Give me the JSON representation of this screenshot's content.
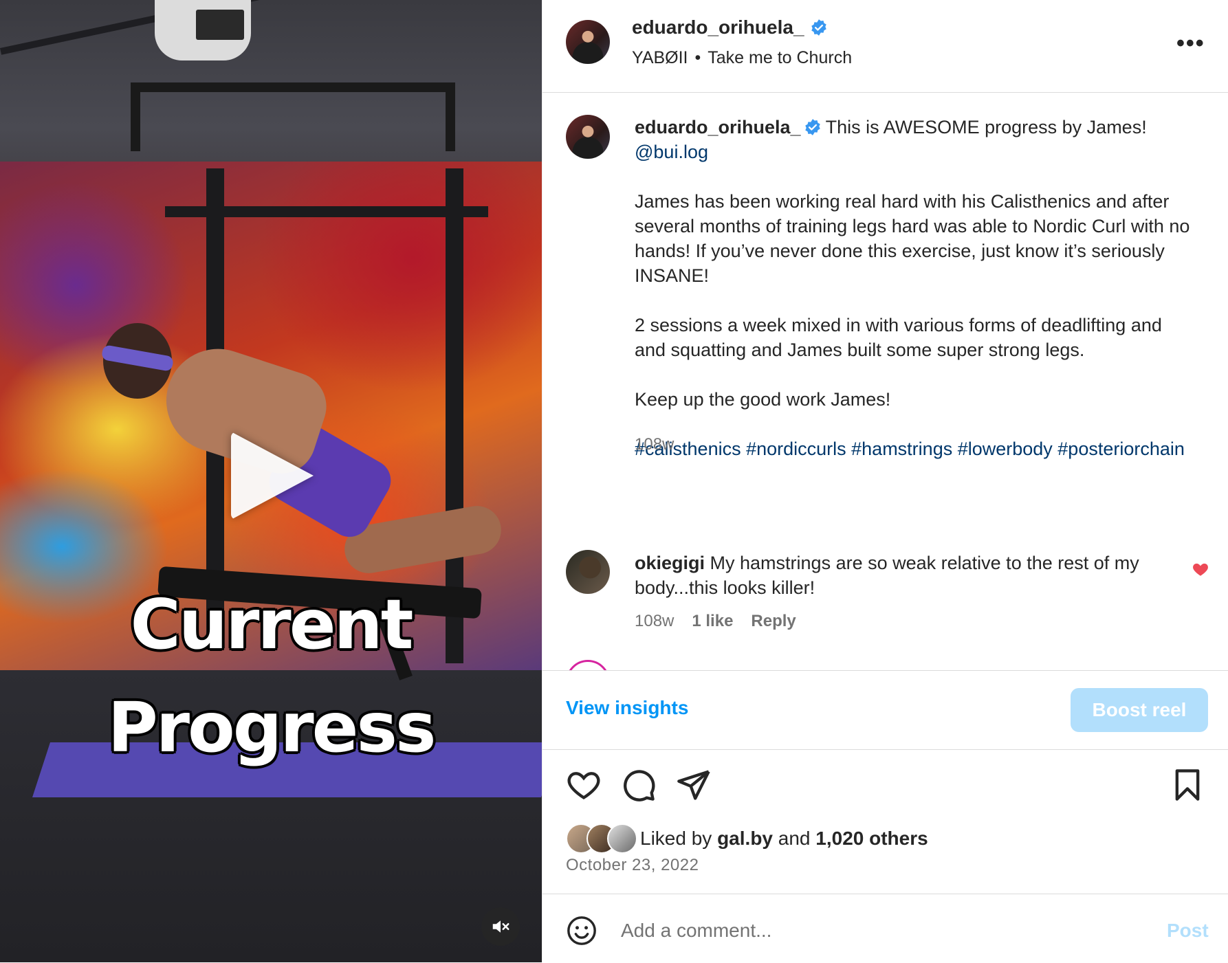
{
  "video": {
    "overlay_line1": "Current",
    "overlay_line2": "Progress",
    "play_icon": "play-icon",
    "mute_icon": "speaker-muted-icon"
  },
  "header": {
    "username": "eduardo_orihuela_",
    "verified": true,
    "audio_artist": "YABØII",
    "separator": "•",
    "audio_track": "Take me to Church",
    "more_label": "•••"
  },
  "caption": {
    "username": "eduardo_orihuela_",
    "intro": "This is AWESOME progress by James!",
    "mention": "@bui.log",
    "para1": "James has been working real hard with his Calisthenics and after several months of training legs hard was able to Nordic Curl with no hands! If you’ve never done this exercise, just know it’s seriously INSANE!",
    "para2": "2 sessions a week mixed in with various forms of deadlifting and and squatting and James built some super strong legs.",
    "para3": "Keep up the good work James!",
    "hashtags": "#calisthenics #nordiccurls #hamstrings #lowerbody #posteriorchain",
    "time": "108w"
  },
  "comment": {
    "username": "okiegigi",
    "text": "My hamstrings are so weak relative to the rest of my body...this looks killer!",
    "time": "108w",
    "likes": "1 like",
    "reply": "Reply",
    "liked": true
  },
  "insights": {
    "view_label": "View insights",
    "boost_label": "Boost reel"
  },
  "likes": {
    "prefix": "Liked by",
    "first_user": "gal.by",
    "conjunction": "and",
    "others": "1,020 others",
    "date": "October 23, 2022"
  },
  "add_comment": {
    "placeholder": "Add a comment...",
    "post_label": "Post"
  },
  "colors": {
    "link_blue": "#0095f6",
    "mention_blue": "#00376b",
    "boost_disabled": "#b2dffc",
    "heart_red": "#ed4956",
    "verified_blue": "#3897f0"
  }
}
